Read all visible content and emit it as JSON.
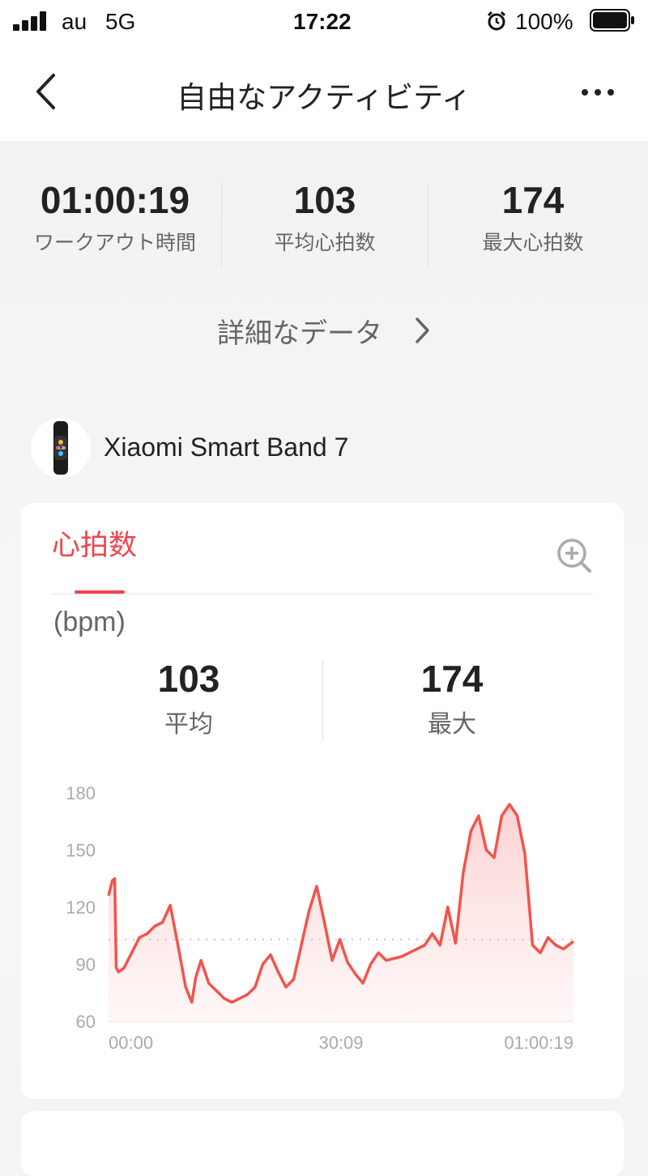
{
  "status_bar": {
    "carrier": "au",
    "network": "5G",
    "time": "17:22",
    "battery": "100%"
  },
  "nav": {
    "title": "自由なアクティビティ",
    "back_icon": "chevron-left-icon",
    "more_icon": "more-horizontal-icon"
  },
  "summary": {
    "stats": [
      {
        "value": "01:00:19",
        "label": "ワークアウト時間"
      },
      {
        "value": "103",
        "label": "平均心拍数"
      },
      {
        "value": "174",
        "label": "最大心拍数"
      }
    ],
    "details_link": "詳細なデータ"
  },
  "device": {
    "name": "Xiaomi Smart Band 7",
    "watch_time": "12"
  },
  "heart_card": {
    "tab_label": "心拍数",
    "zoom_icon": "zoom-in-icon",
    "unit": "(bpm)",
    "avg_value": "103",
    "avg_label": "平均",
    "max_value": "174",
    "max_label": "最大"
  },
  "colors": {
    "accent": "#f0454f",
    "line": "#f2544b",
    "fill": "#fde3e3"
  },
  "chart_data": {
    "type": "area",
    "ylim": [
      60,
      180
    ],
    "yticks": [
      "180",
      "150",
      "120",
      "90",
      "60"
    ],
    "xticks": [
      "00:00",
      "30:09",
      "01:00:19"
    ],
    "xlim_minutes": [
      0,
      60.3
    ],
    "average_line": 103,
    "x": [
      0,
      0.5,
      0.8,
      1.0,
      1.3,
      2.0,
      3,
      4,
      5,
      6,
      7,
      8,
      9,
      10,
      10.8,
      11.3,
      12,
      13,
      14,
      15,
      16,
      17,
      18,
      19,
      20,
      21,
      22,
      23,
      24,
      25,
      26,
      27,
      28,
      29,
      30,
      31,
      32,
      33,
      34,
      35,
      36,
      37,
      38,
      39,
      40,
      41,
      42,
      43,
      44,
      45,
      46,
      47,
      48,
      49,
      50,
      51,
      52,
      53,
      54,
      55,
      56,
      57,
      58,
      59,
      60.3
    ],
    "values": [
      126,
      134,
      135,
      88,
      86,
      88,
      96,
      104,
      106,
      110,
      112,
      121,
      100,
      78,
      70,
      83,
      92,
      80,
      76,
      72,
      70,
      72,
      74,
      78,
      90,
      95,
      86,
      78,
      82,
      100,
      118,
      131,
      112,
      92,
      103,
      91,
      85,
      80,
      90,
      96,
      92,
      93,
      94,
      96,
      98,
      100,
      106,
      100,
      120,
      101,
      138,
      160,
      168,
      150,
      146,
      168,
      174,
      168,
      148,
      100,
      96,
      104,
      100,
      98,
      102
    ]
  }
}
